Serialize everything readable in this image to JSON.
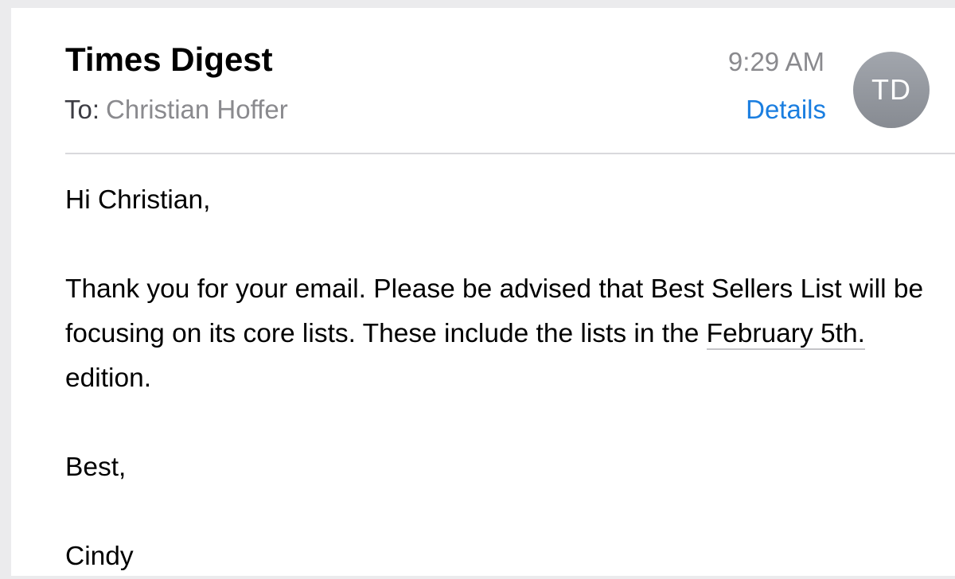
{
  "header": {
    "sender": "Times Digest",
    "to_label": "To:",
    "recipient": "Christian Hoffer",
    "time": "9:29 AM",
    "details_label": "Details",
    "avatar_initials": "TD"
  },
  "body": {
    "greeting": "Hi Christian,",
    "paragraph_before_link": "Thank you for your email. Please be advised that Best Sellers List will be focusing on its core lists. These include the lists in the ",
    "date_link": "February 5th.",
    "paragraph_after_link": " edition.",
    "signoff": "Best,",
    "signature": "Cindy"
  },
  "colors": {
    "accent": "#1a7ee0",
    "secondary_text": "#8a8a8e",
    "avatar": "#969aa1",
    "background": "#ebebed"
  }
}
